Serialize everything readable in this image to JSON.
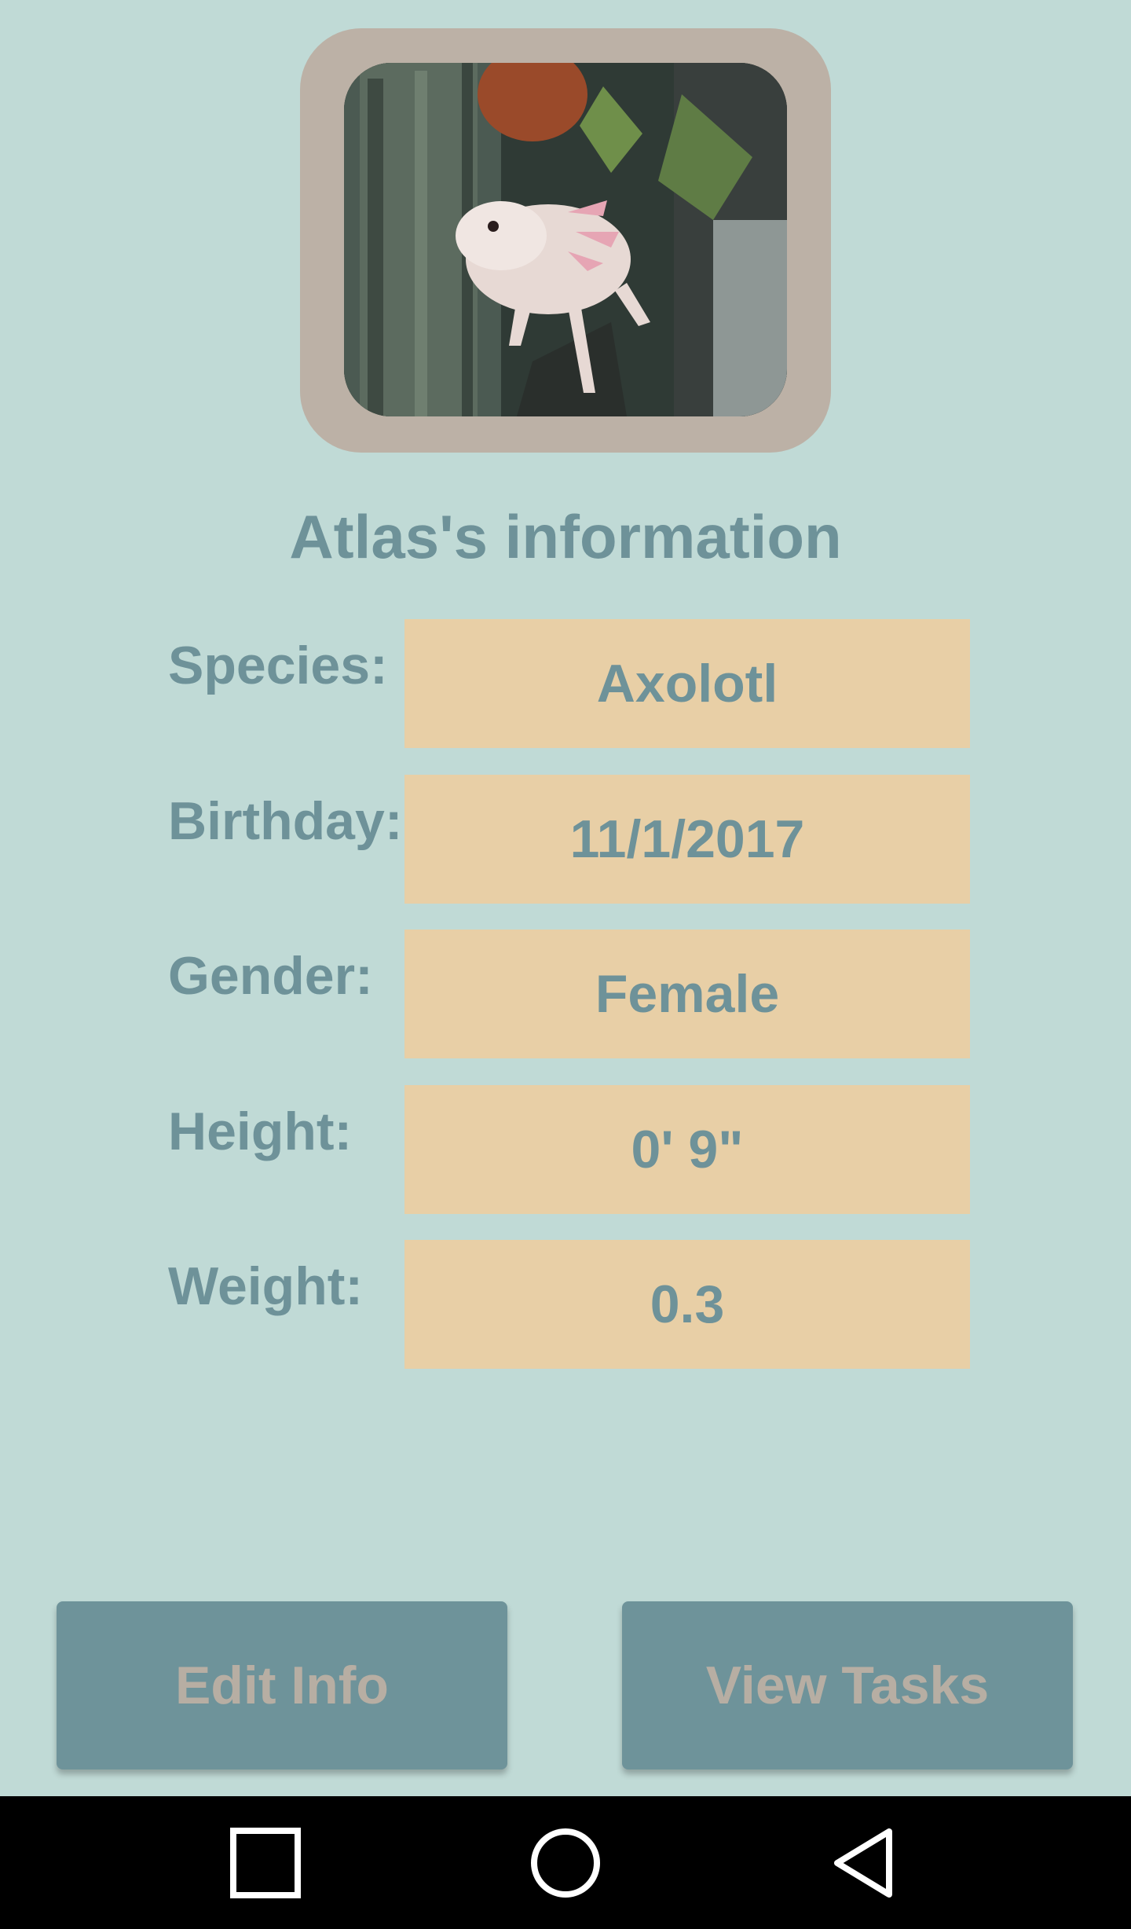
{
  "pet": {
    "photo_alt": "axolotl-photo",
    "title": "Atlas's information"
  },
  "fields": [
    {
      "label": "Species:",
      "value": "Axolotl"
    },
    {
      "label": "Birthday:",
      "value": "11/1/2017"
    },
    {
      "label": "Gender:",
      "value": "Female"
    },
    {
      "label": "Height:",
      "value": "0' 9\""
    },
    {
      "label": "Weight:",
      "value": "0.3"
    }
  ],
  "actions": {
    "edit_label": "Edit Info",
    "tasks_label": "View Tasks"
  },
  "navigation": {
    "recents_icon": "square-icon",
    "home_icon": "circle-icon",
    "back_icon": "triangle-back-icon"
  },
  "colors": {
    "background": "#c0dad6",
    "value_box": "#e8cfa6",
    "text": "#6e9299",
    "button": "#6e939a",
    "button_text": "#b7aea3",
    "frame": "#bcb1a6"
  }
}
